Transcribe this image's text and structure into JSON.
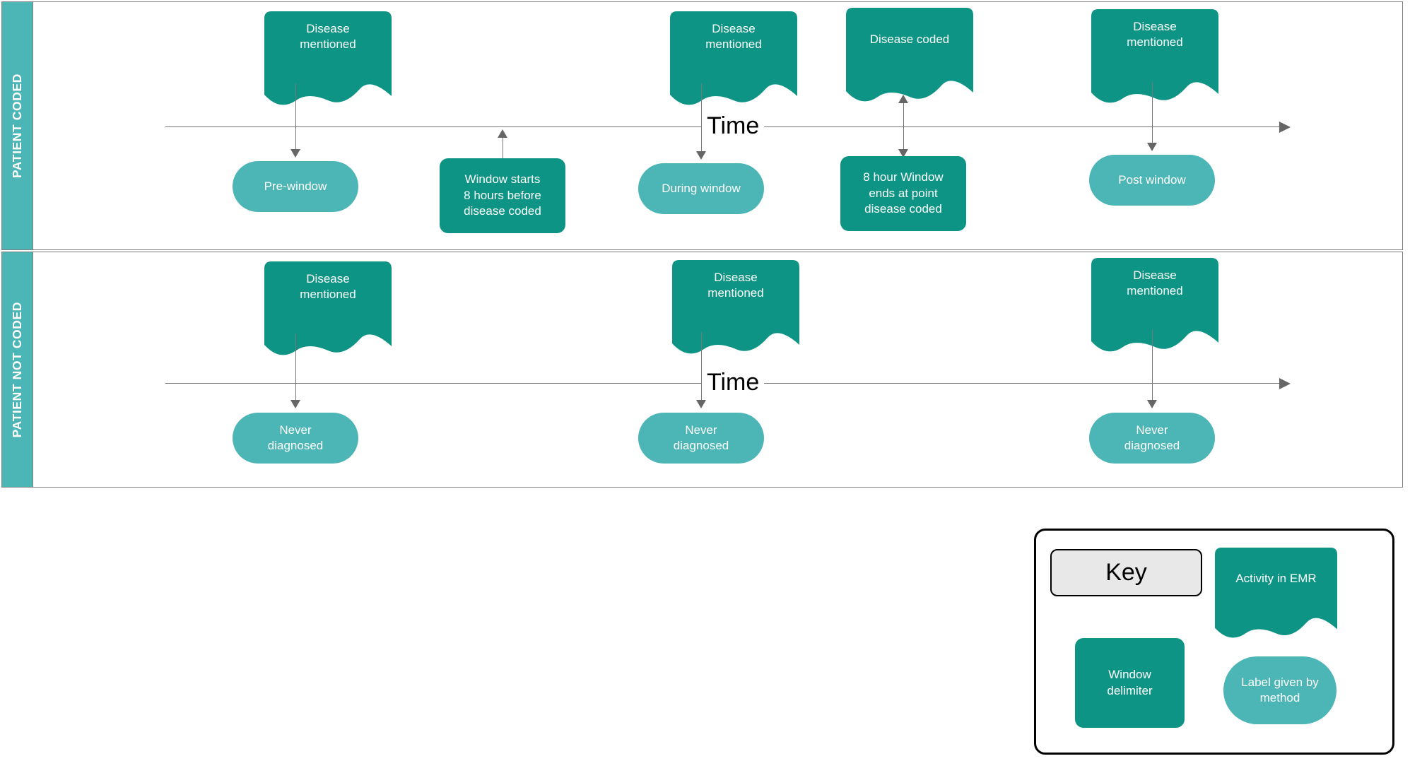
{
  "colors": {
    "activity_fill": "#0D9484",
    "label_fill": "#4CB5B5",
    "lane_header_fill": "#4CB5B5",
    "lane_border": "#808080",
    "connector": "#777777",
    "key_title_fill": "#E8E8E8",
    "key_border": "#000000",
    "shape_text": "#FFFFFF",
    "time_text": "#000000"
  },
  "lanes": [
    {
      "id": "patient-coded",
      "header": "PATIENT CODED",
      "timeline_label": "Time",
      "activities": [
        {
          "id": "a1",
          "label": "Disease\nmentioned"
        },
        {
          "id": "a2",
          "label": "Disease\nmentioned"
        },
        {
          "id": "a3",
          "label": "Disease coded"
        },
        {
          "id": "a4",
          "label": "Disease\nmentioned"
        }
      ],
      "labels": [
        {
          "id": "l1",
          "label": "Pre-window"
        },
        {
          "id": "l2",
          "label": "During window"
        },
        {
          "id": "l3",
          "label": "Post window"
        }
      ],
      "delimiters": [
        {
          "id": "d1",
          "label": "Window starts\n8 hours before\ndisease coded"
        },
        {
          "id": "d2",
          "label": "8 hour Window\nends at  point\ndisease coded"
        }
      ]
    },
    {
      "id": "patient-not-coded",
      "header": "PATIENT NOT CODED",
      "timeline_label": "Time",
      "activities": [
        {
          "id": "b1",
          "label": "Disease\nmentioned"
        },
        {
          "id": "b2",
          "label": "Disease\nmentioned"
        },
        {
          "id": "b3",
          "label": "Disease\nmentioned"
        }
      ],
      "labels": [
        {
          "id": "m1",
          "label": "Never\ndiagnosed"
        },
        {
          "id": "m2",
          "label": "Never\ndiagnosed"
        },
        {
          "id": "m3",
          "label": "Never\ndiagnosed"
        }
      ],
      "delimiters": []
    }
  ],
  "key": {
    "title": "Key",
    "items": [
      {
        "id": "k-activity",
        "label": "Activity in EMR",
        "shape": "document"
      },
      {
        "id": "k-delimiter",
        "label": "Window\ndelimiter",
        "shape": "rounded-rect"
      },
      {
        "id": "k-label",
        "label": "Label given by\nmethod",
        "shape": "pill"
      }
    ]
  }
}
